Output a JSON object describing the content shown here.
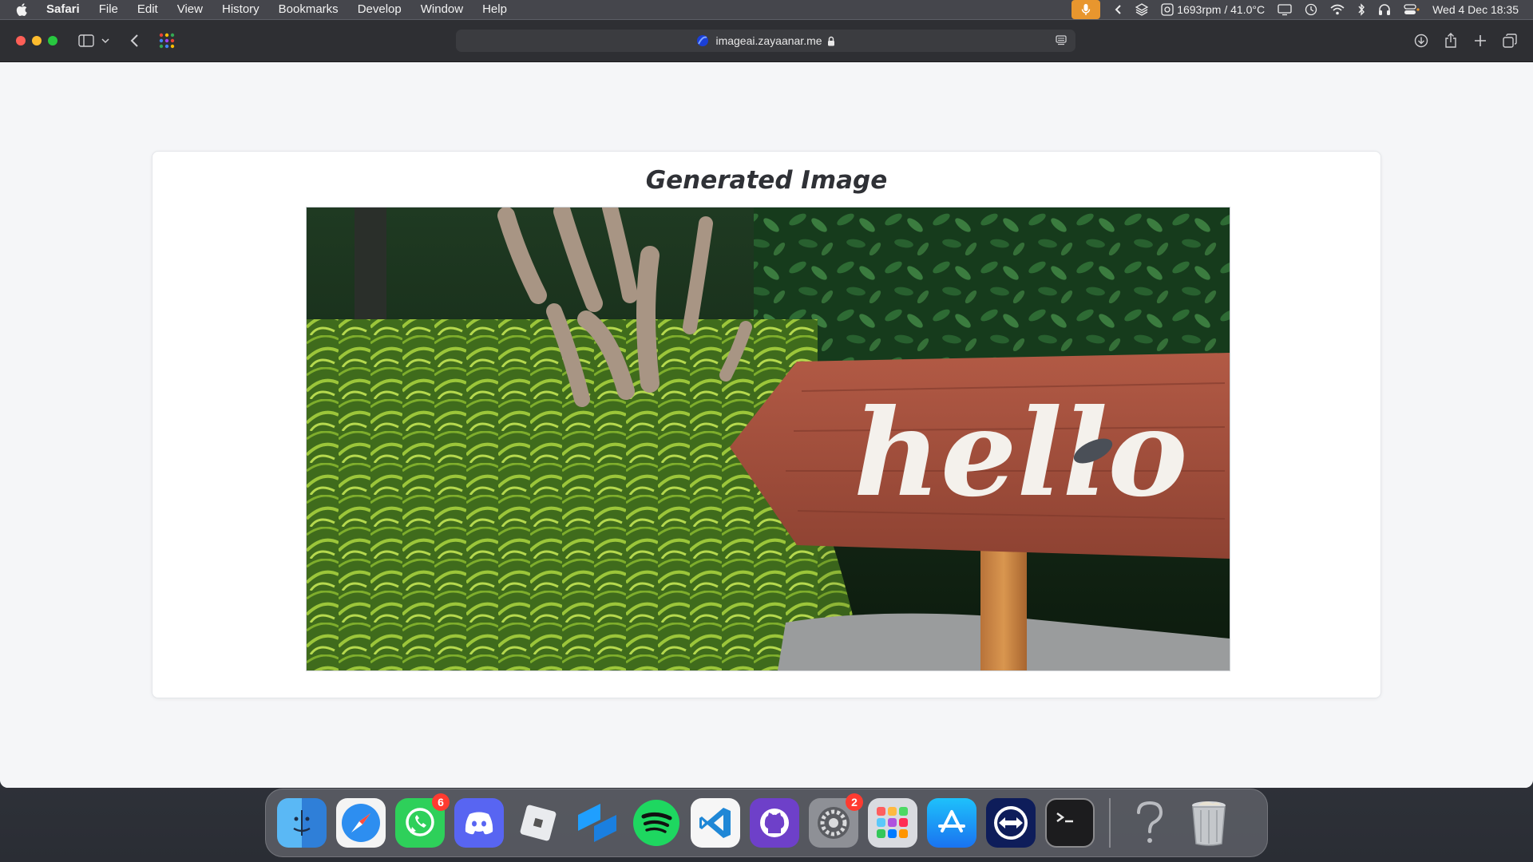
{
  "menubar": {
    "app_name": "Safari",
    "menus": [
      "File",
      "Edit",
      "View",
      "History",
      "Bookmarks",
      "Develop",
      "Window",
      "Help"
    ],
    "fan_temp": "1693rpm / 41.0°C",
    "datetime": "Wed 4 Dec  18:35"
  },
  "browser": {
    "url": "imageai.zayaanar.me"
  },
  "page": {
    "title": "Generated Image",
    "image": {
      "description_icon": "generated-image",
      "sign_text": "hello"
    }
  },
  "dock": {
    "apps": [
      {
        "name": "Finder",
        "icon": "finder-icon"
      },
      {
        "name": "Safari",
        "icon": "safari-icon"
      },
      {
        "name": "WhatsApp",
        "icon": "whatsapp-icon",
        "badge": "6"
      },
      {
        "name": "Discord",
        "icon": "discord-icon"
      },
      {
        "name": "Roblox",
        "icon": "roblox-icon"
      },
      {
        "name": "Roblox Studio",
        "icon": "roblox-studio-icon"
      },
      {
        "name": "Spotify",
        "icon": "spotify-icon"
      },
      {
        "name": "Visual Studio Code",
        "icon": "vscode-icon"
      },
      {
        "name": "GitHub Desktop",
        "icon": "github-icon"
      },
      {
        "name": "System Settings",
        "icon": "settings-icon",
        "badge": "2"
      },
      {
        "name": "Launchpad",
        "icon": "launchpad-icon"
      },
      {
        "name": "App Store",
        "icon": "app-store-icon"
      },
      {
        "name": "TeamViewer",
        "icon": "teamviewer-icon"
      },
      {
        "name": "Terminal",
        "icon": "terminal-icon"
      },
      {
        "name": "Unknown",
        "icon": "question-icon"
      },
      {
        "name": "Trash",
        "icon": "trash-icon"
      }
    ]
  },
  "colors": {
    "menubar_bg": "#45464c",
    "toolbar_bg": "#2e2f33",
    "page_bg": "#f5f6f8",
    "title_color": "#2f3136"
  }
}
